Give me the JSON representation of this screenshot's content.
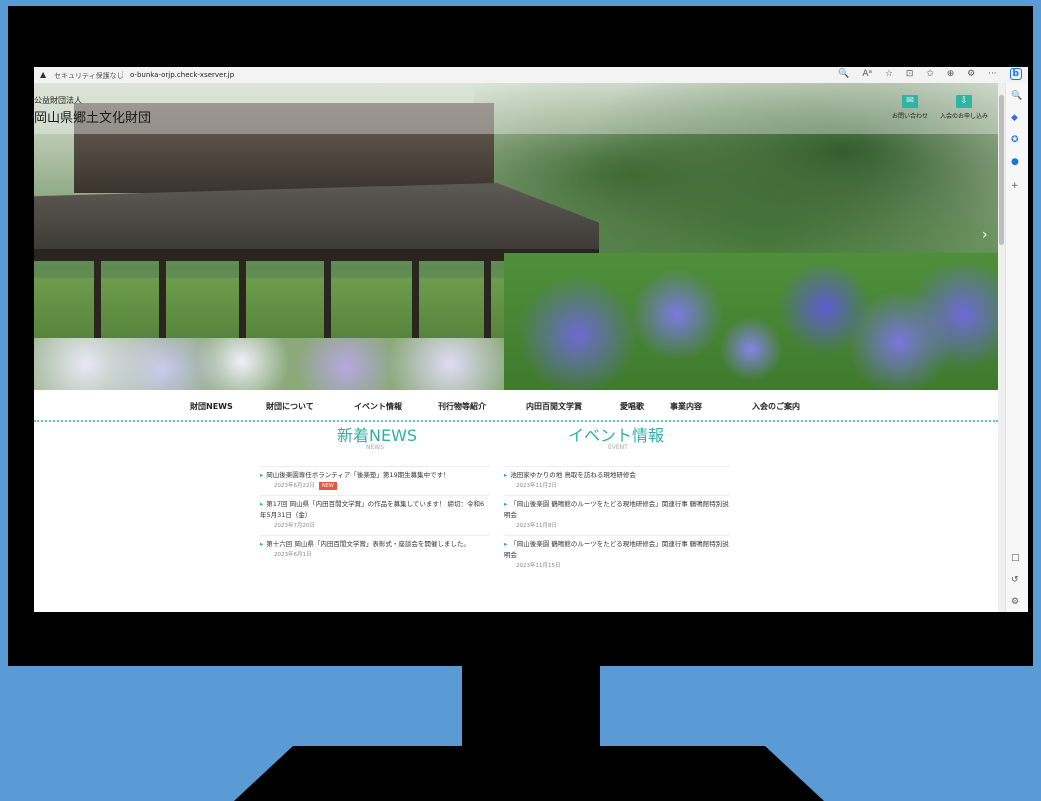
{
  "browser": {
    "security_text": "セキュリティ保護なし",
    "separator": "|",
    "url": "o-bunka-orjp.check-xserver.jp",
    "tools": [
      "🔍",
      "Aᵃ",
      "☆",
      "⊡",
      "✩",
      "⊕",
      "⚙",
      "···",
      "b"
    ],
    "sidebar_icons": [
      "🔍",
      "◆",
      "✪",
      "●",
      "+",
      "□",
      "↺",
      "⚙"
    ]
  },
  "header": {
    "org_sub": "公益財団法人",
    "org_name": "岡山県郷土文化財団",
    "contact_label": "お問い合わせ",
    "join_label": "入会のお申し込み"
  },
  "nav": {
    "items": [
      "財団NEWS",
      "財団について",
      "イベント情報",
      "刊行物等紹介",
      "内田百閒文学賞",
      "愛唱歌",
      "事業内容",
      "入会のご案内"
    ]
  },
  "news": {
    "title": "新着NEWS",
    "subtitle": "NEWS",
    "items": [
      {
        "text": "岡山後楽園専任ボランティア「後楽塾」第19期生募集中です！",
        "date": "2023年6月22日",
        "badge": "NEW"
      },
      {
        "text": "第17回 岡山県「内田百閒文学賞」の作品を募集しています！ 締切：令和6年5月31日（金）",
        "date": "2023年7月20日",
        "badge": ""
      },
      {
        "text": "第十六回 岡山県「内田百閒文学賞」表彰式・座談会を開催しました。",
        "date": "2023年6月1日",
        "badge": ""
      }
    ]
  },
  "events": {
    "title": "イベント情報",
    "subtitle": "EVENT",
    "items": [
      {
        "text": "池田家ゆかりの地 鳥取を訪ねる現地研修会",
        "date": "2023年11月2日"
      },
      {
        "text": "「岡山後楽園 鶴鳴館のルーツをたどる現地研修会」関連行事 鶴鳴館特別説明会",
        "date": "2023年11月8日"
      },
      {
        "text": "「岡山後楽園 鶴鳴館のルーツをたどる現地研修会」関連行事 鶴鳴館特別説明会",
        "date": "2023年11月15日"
      }
    ]
  },
  "colors": {
    "accent": "#2fb0a6",
    "badge": "#e8563d",
    "background": "#5b9bd5"
  }
}
